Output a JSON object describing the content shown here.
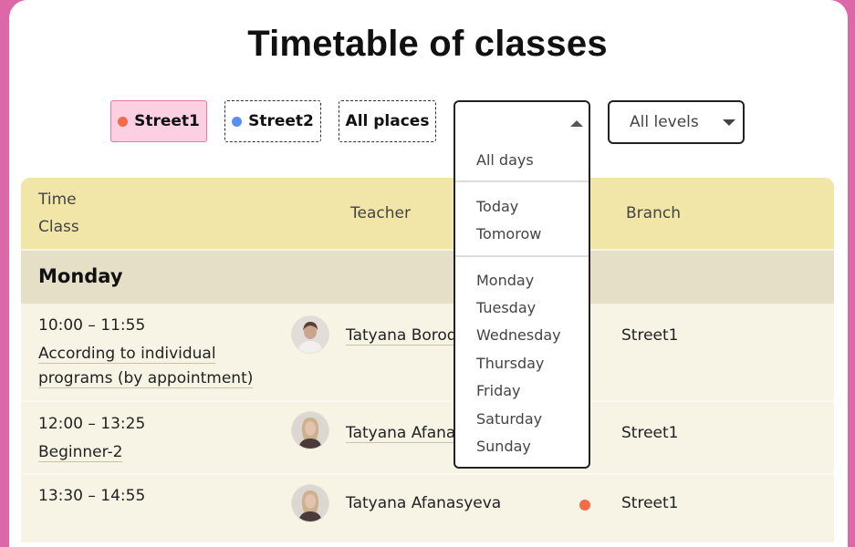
{
  "title": "Timetable of classes",
  "filters": {
    "street1": "Street1",
    "street2": "Street2",
    "all_places": "All places",
    "levels": "All levels"
  },
  "day_dropdown": {
    "all_days": "All days",
    "relative": [
      "Today",
      "Tomorow"
    ],
    "weekdays": [
      "Monday",
      "Tuesday",
      "Wednesday",
      "Thursday",
      "Friday",
      "Saturday",
      "Sunday"
    ]
  },
  "table": {
    "headers": {
      "time": "Time",
      "class": "Class",
      "teacher": "Teacher",
      "branch": "Branch"
    },
    "day": "Monday",
    "rows": [
      {
        "time": "10:00 – 11:55",
        "class_line1": "According to individual",
        "class_line2": "programs (by appointment)",
        "teacher": "Tatyana Boroda",
        "branch": "Street1"
      },
      {
        "time": "12:00 – 13:25",
        "class_line1": "Beginner-2",
        "teacher": "Tatyana Afanas",
        "branch": "Street1"
      },
      {
        "time": "13:30 – 14:55",
        "teacher": "Tatyana Afanasyeva",
        "branch": "Street1"
      }
    ]
  },
  "colors": {
    "street1_dot": "#f26b4b",
    "street2_dot": "#5a8ef0",
    "header_bg": "#f1e5a8",
    "page_border": "#dc68a8"
  }
}
